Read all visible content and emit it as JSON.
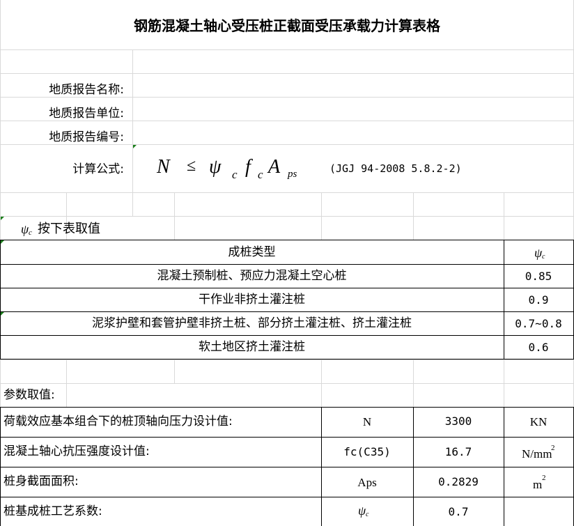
{
  "title": "钢筋混凝土轴心受压桩正截面受压承载力计算表格",
  "report": {
    "name_label": "地质报告名称:",
    "unit_label": "地质报告单位:",
    "number_label": "地质报告编号:"
  },
  "formula": {
    "label": "计算公式:",
    "N": "N",
    "le": "≤",
    "psi": "ψ",
    "c1": "c",
    "f": "f",
    "c2": "c",
    "A": "A",
    "ps": "ps",
    "reference": "(JGJ 94-2008 5.8.2-2)"
  },
  "psi_table": {
    "intro_psi": "ψ",
    "intro_sub": "c",
    "intro_text": "按下表取值",
    "header_type": "成桩类型",
    "header_psi": "ψ",
    "header_sub": "c",
    "rows": [
      {
        "type": "混凝土预制桩、预应力混凝土空心桩",
        "value": "0.85"
      },
      {
        "type": "干作业非挤土灌注桩",
        "value": "0.9"
      },
      {
        "type": "泥浆护壁和套管护壁非挤土桩、部分挤土灌注桩、挤土灌注桩",
        "value": "0.7~0.8"
      },
      {
        "type": "软土地区挤土灌注桩",
        "value": "0.6"
      }
    ]
  },
  "params": {
    "heading": "参数取值:",
    "rows": [
      {
        "label": "荷载效应基本组合下的桩顶轴向压力设计值:",
        "symbol": "N",
        "value": "3300",
        "unit": "KN"
      },
      {
        "label": "混凝土轴心抗压强度设计值:",
        "symbol": "fc(C35)",
        "value": "16.7",
        "unit": "N/mm",
        "unit_sup": "2"
      },
      {
        "label": "桩身截面面积:",
        "symbol": "Aps",
        "value": "0.2829",
        "unit": "m",
        "unit_sup": "2"
      },
      {
        "label": "桩基成桩工艺系数:",
        "symbol_psi": "ψ",
        "symbol_sub": "c",
        "value": "0.7",
        "unit": ""
      }
    ]
  }
}
